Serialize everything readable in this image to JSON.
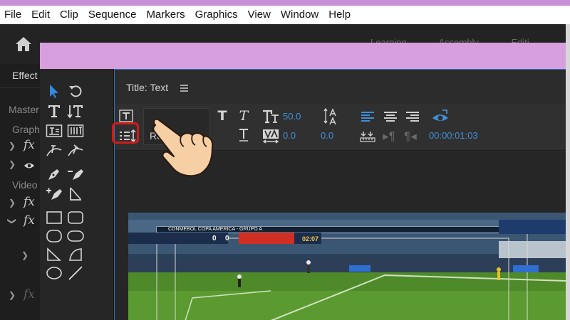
{
  "menu": [
    "File",
    "Edit",
    "Clip",
    "Sequence",
    "Markers",
    "Graphics",
    "View",
    "Window",
    "Help"
  ],
  "workspaces": [
    "Learning",
    "Assembly",
    "Editi"
  ],
  "colors": {
    "banner": "#d79fde",
    "accent": "#3f8fd8",
    "highlight": "#d11a1a"
  },
  "left_panel": {
    "tab": "Effect",
    "master": "Master",
    "graphics": "Graph",
    "video": "Video",
    "fx": "fx"
  },
  "title_panel": {
    "header": "Title: Text",
    "font_style": "Reg",
    "font_size": "50.0",
    "leading": "0.0",
    "kerning": "0.0",
    "timecode": "00:00:01:03"
  },
  "video": {
    "league": "CONMEBOL COPA AMERICA - GRUPO A",
    "score_home": "0",
    "score_away": "0",
    "clock": "02:07"
  },
  "icons": [
    "home-icon",
    "selection-tool-icon",
    "rotate-tool-icon",
    "type-tool-icon",
    "vertical-type-tool-icon",
    "pen-tool-icon",
    "rectangle-tool-icon",
    "ellipse-tool-icon",
    "line-tool-icon",
    "bold-icon",
    "italic-icon",
    "align-left-icon",
    "align-center-icon",
    "align-right-icon",
    "eye-icon",
    "hand-pointer-icon"
  ]
}
